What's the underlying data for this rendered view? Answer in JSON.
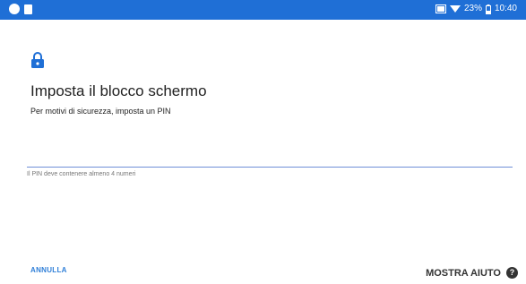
{
  "status_bar": {
    "icons_left": [
      "circle-notification-icon",
      "sd-card-icon"
    ],
    "icons_right": [
      "screen-cast-icon",
      "wifi-icon",
      "battery-icon"
    ],
    "battery": "23%",
    "time": "10:40"
  },
  "screen": {
    "icon": "lock-icon",
    "title": "Imposta il blocco schermo",
    "subtitle": "Per motivi di sicurezza, imposta un PIN",
    "pin_value": "",
    "hint": "Il PIN deve contenere almeno 4 numeri"
  },
  "footer": {
    "cancel_label": "ANNULLA",
    "help_label": "MOSTRA AIUTO",
    "help_icon_glyph": "?"
  },
  "colors": {
    "status_bar": "#1f6fd6",
    "accent": "#2f7fd8"
  }
}
